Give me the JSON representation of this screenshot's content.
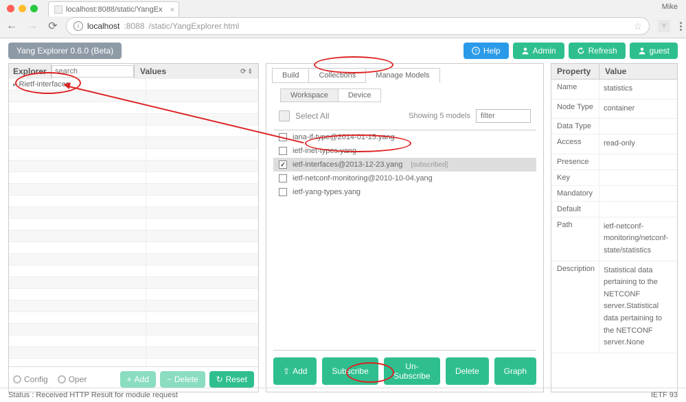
{
  "browser": {
    "user": "Mike",
    "tab_title": "localhost:8088/static/YangEx",
    "url_host": "localhost",
    "url_port": ":8088",
    "url_path": "/static/YangExplorer.html"
  },
  "header": {
    "version_badge": "Yang Explorer 0.6.0 (Beta)",
    "help": "Help",
    "admin": "Admin",
    "refresh": "Refresh",
    "guest": "guest"
  },
  "explorer": {
    "title": "Explorer",
    "search_placeholder": "search",
    "values_title": "Values",
    "tree_item": "Rietf-interfaces",
    "config_label": "Config",
    "oper_label": "Oper",
    "add_btn": "Add",
    "delete_btn": "Delete",
    "reset_btn": "Reset"
  },
  "center": {
    "tabs_outer": {
      "build": "Build",
      "collections": "Collections",
      "manage": "Manage Models"
    },
    "tabs_inner": {
      "workspace": "Workspace",
      "device": "Device"
    },
    "select_all": "Select All",
    "showing": "Showing 5 models",
    "filter_placeholder": "filter",
    "subscribed_tag": "[subscribed]",
    "models": [
      {
        "name": "iana-if-type@2014-01-15.yang",
        "checked": false,
        "subscribed": false
      },
      {
        "name": "ietf-inet-types.yang",
        "checked": false,
        "subscribed": false
      },
      {
        "name": "ietf-interfaces@2013-12-23.yang",
        "checked": true,
        "subscribed": true
      },
      {
        "name": "ietf-netconf-monitoring@2010-10-04.yang",
        "checked": false,
        "subscribed": false
      },
      {
        "name": "ietf-yang-types.yang",
        "checked": false,
        "subscribed": false
      }
    ],
    "footer": {
      "add": "Add",
      "subscribe": "Subscribe",
      "unsubscribe": "Un-Subscribe",
      "delete": "Delete",
      "graph": "Graph"
    }
  },
  "properties": {
    "header": {
      "prop": "Property",
      "val": "Value"
    },
    "rows": [
      {
        "k": "Name",
        "v": "statistics"
      },
      {
        "k": "Node Type",
        "v": "container"
      },
      {
        "k": "Data Type",
        "v": ""
      },
      {
        "k": "Access",
        "v": "read-only"
      },
      {
        "k": "Presence",
        "v": ""
      },
      {
        "k": "Key",
        "v": ""
      },
      {
        "k": "Mandatory",
        "v": ""
      },
      {
        "k": "Default",
        "v": ""
      },
      {
        "k": "Path",
        "v": "ietf-netconf-monitoring/netconf-state/statistics"
      },
      {
        "k": "Description",
        "v": "Statistical data pertaining to the NETCONF server.Statistical data pertaining to the NETCONF server.None"
      }
    ]
  },
  "status": {
    "left": "Status : Received HTTP Result for module request",
    "right": "IETF 93"
  }
}
